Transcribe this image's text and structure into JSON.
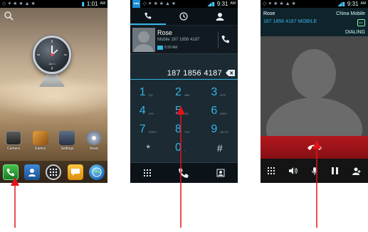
{
  "status_bar": {
    "screen1_time": "1:01",
    "screen1_ampm": "AM",
    "screen2_time": "9:31",
    "screen2_ampm": "AM",
    "screen3_time": "9:31",
    "screen3_ampm": "AM"
  },
  "home": {
    "clock_date": "Jan 1",
    "apps": [
      {
        "label": "Camera",
        "icon": "camera-icon"
      },
      {
        "label": "Gallery",
        "icon": "gallery-icon"
      },
      {
        "label": "Settings",
        "icon": "settings-icon"
      },
      {
        "label": "Music",
        "icon": "music-icon"
      }
    ],
    "dock": [
      "phone-icon",
      "contacts-icon",
      "app-drawer-icon",
      "messaging-icon",
      "browser-icon"
    ]
  },
  "dialer": {
    "tabs": [
      "phone-tab-icon",
      "call-log-tab-icon",
      "contacts-tab-icon"
    ],
    "recent_contact": {
      "name": "Rose",
      "number": "Mobile 187 1856 4187",
      "time": "9:39 AM"
    },
    "entered_number": "187 1856 4187",
    "keys": [
      {
        "digit": "1",
        "letters": "QO"
      },
      {
        "digit": "2",
        "letters": "ABC"
      },
      {
        "digit": "3",
        "letters": "DEF"
      },
      {
        "digit": "4",
        "letters": "GHI"
      },
      {
        "digit": "5",
        "letters": "JKL"
      },
      {
        "digit": "6",
        "letters": "MNO"
      },
      {
        "digit": "7",
        "letters": "PQRS"
      },
      {
        "digit": "8",
        "letters": "TUV"
      },
      {
        "digit": "9",
        "letters": "WXYZ"
      },
      {
        "digit": "*",
        "letters": ""
      },
      {
        "digit": "0",
        "letters": "+"
      },
      {
        "digit": "#",
        "letters": ""
      }
    ]
  },
  "calling": {
    "name": "Rose",
    "carrier": "China Mobile",
    "number": "187 1856 4187 MOBILE",
    "state": "DIALING"
  },
  "colors": {
    "accent": "#33b5e5",
    "end_call": "#b3181d",
    "arrow": "#e3131b"
  }
}
